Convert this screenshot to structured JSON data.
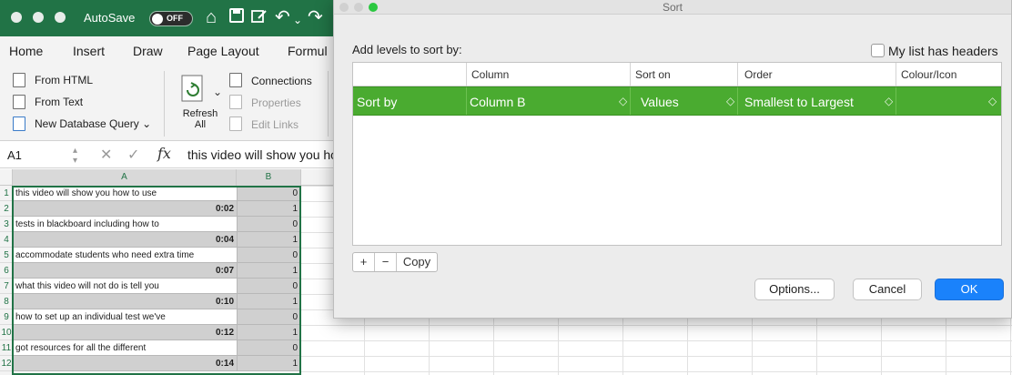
{
  "titlebar": {
    "autosave_label": "AutoSave",
    "autosave_state": "OFF"
  },
  "ribbon": {
    "tabs": [
      "Home",
      "Insert",
      "Draw",
      "Page Layout",
      "Formul"
    ],
    "get_data": {
      "from_html": "From HTML",
      "from_text": "From Text",
      "new_db_query": "New Database Query"
    },
    "refresh": {
      "line1": "Refresh",
      "line2": "All"
    },
    "queries": {
      "connections": "Connections",
      "properties": "Properties",
      "edit_links": "Edit Links"
    }
  },
  "formula_bar": {
    "name_box": "A1",
    "fx_symbol": "fx",
    "content": "this video will show you ho"
  },
  "grid": {
    "col_headers": [
      "A",
      "B"
    ],
    "rows": [
      {
        "num": "1",
        "a": "this video will show you how to use",
        "b": "0",
        "a_type": "text"
      },
      {
        "num": "2",
        "a": "0:02",
        "b": "1",
        "a_type": "time"
      },
      {
        "num": "3",
        "a": "tests in blackboard including how to",
        "b": "0",
        "a_type": "text"
      },
      {
        "num": "4",
        "a": "0:04",
        "b": "1",
        "a_type": "time"
      },
      {
        "num": "5",
        "a": "accommodate students who need extra time",
        "b": "0",
        "a_type": "text"
      },
      {
        "num": "6",
        "a": "0:07",
        "b": "1",
        "a_type": "time"
      },
      {
        "num": "7",
        "a": "what this video will not do is tell you",
        "b": "0",
        "a_type": "text"
      },
      {
        "num": "8",
        "a": "0:10",
        "b": "1",
        "a_type": "time"
      },
      {
        "num": "9",
        "a": "how to set up an individual test we've",
        "b": "0",
        "a_type": "text"
      },
      {
        "num": "10",
        "a": "0:12",
        "b": "1",
        "a_type": "time"
      },
      {
        "num": "11",
        "a": "got resources for all the different",
        "b": "0",
        "a_type": "text"
      },
      {
        "num": "12",
        "a": "0:14",
        "b": "1",
        "a_type": "time"
      }
    ]
  },
  "dialog": {
    "title": "Sort",
    "heading": "Add levels to sort by:",
    "headers_checkbox": "My list has headers",
    "columns": {
      "column": "Column",
      "sort_on": "Sort on",
      "order": "Order",
      "colour": "Colour/Icon"
    },
    "level": {
      "label": "Sort by",
      "column": "Column B",
      "sort_on": "Values",
      "order": "Smallest to Largest"
    },
    "add_label": "+",
    "remove_label": "−",
    "copy_label": "Copy",
    "options_label": "Options...",
    "cancel_label": "Cancel",
    "ok_label": "OK"
  },
  "colors": {
    "excel_green": "#217346",
    "selected_row": "#4aab30",
    "ok_blue": "#1a82fb"
  }
}
